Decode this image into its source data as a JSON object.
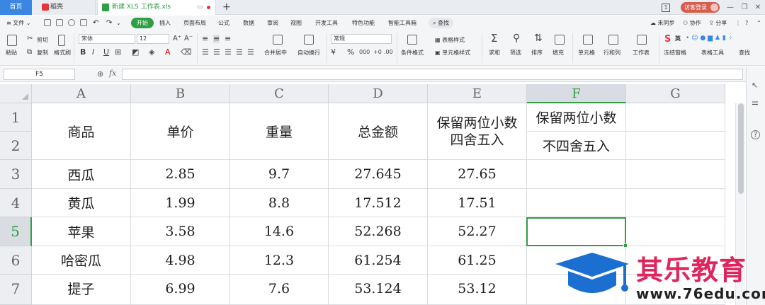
{
  "tabs": {
    "home": "首页",
    "wps": "稻壳",
    "file": "新建 XLS 工作表.xls",
    "new_tab": "+"
  },
  "titlebar": {
    "guest_login": "访客登录",
    "page_count": "1"
  },
  "menu": {
    "file": "文件",
    "items": [
      "开始",
      "插入",
      "页面布局",
      "公式",
      "数据",
      "审阅",
      "视图",
      "开发工具",
      "特色功能",
      "智能工具箱"
    ],
    "search": "查找",
    "sync": "未同步",
    "collab": "协作",
    "share": "分享"
  },
  "ribbon": {
    "paste": "粘贴",
    "cut": "剪切",
    "copy": "复制",
    "format_painter": "格式刷",
    "font_name": "宋体",
    "font_size": "12",
    "merge_center": "合并居中",
    "auto_wrap": "自动换行",
    "number_format": "常规",
    "cond_format": "条件格式",
    "table_style": "表格样式",
    "cell_style": "单元格样式",
    "sum": "求和",
    "filter": "筛选",
    "sort": "排序",
    "fill": "填充",
    "cells": "单元格",
    "rows_cols": "行和列",
    "worksheet": "工作表",
    "freeze": "冻结窗格",
    "table_tools": "表格工具",
    "find": "查找",
    "ime": "英"
  },
  "formula_bar": {
    "name_box": "F5",
    "fx": "fx",
    "formula": ""
  },
  "sheet": {
    "columns": [
      "A",
      "B",
      "C",
      "D",
      "E",
      "F",
      "G"
    ],
    "rows": [
      "1",
      "2",
      "3",
      "4",
      "5",
      "6",
      "7"
    ],
    "selected_cell": "F5",
    "header": {
      "a": "商品",
      "b": "单价",
      "c": "重量",
      "d": "总金额",
      "e1": "保留两位小数",
      "e2": "四舍五入",
      "f1": "保留两位小数",
      "f2": "不四舍五入"
    },
    "data": [
      {
        "name": "西瓜",
        "price": "2.85",
        "weight": "9.7",
        "total": "27.645",
        "rounded": "27.65"
      },
      {
        "name": "黄瓜",
        "price": "1.99",
        "weight": "8.8",
        "total": "17.512",
        "rounded": "17.51"
      },
      {
        "name": "苹果",
        "price": "3.58",
        "weight": "14.6",
        "total": "52.268",
        "rounded": "52.27"
      },
      {
        "name": "哈密瓜",
        "price": "4.98",
        "weight": "12.3",
        "total": "61.254",
        "rounded": "61.25"
      },
      {
        "name": "提子",
        "price": "6.99",
        "weight": "7.6",
        "total": "53.124",
        "rounded": "53.12"
      }
    ]
  },
  "watermark": {
    "name": "其乐教育",
    "url": "www.76edu.com"
  },
  "colors": {
    "accent_green": "#2f9e44",
    "home_tab_blue": "#3a86e3",
    "watermark_blue": "#1a6fd0",
    "watermark_red": "#e0245e"
  }
}
